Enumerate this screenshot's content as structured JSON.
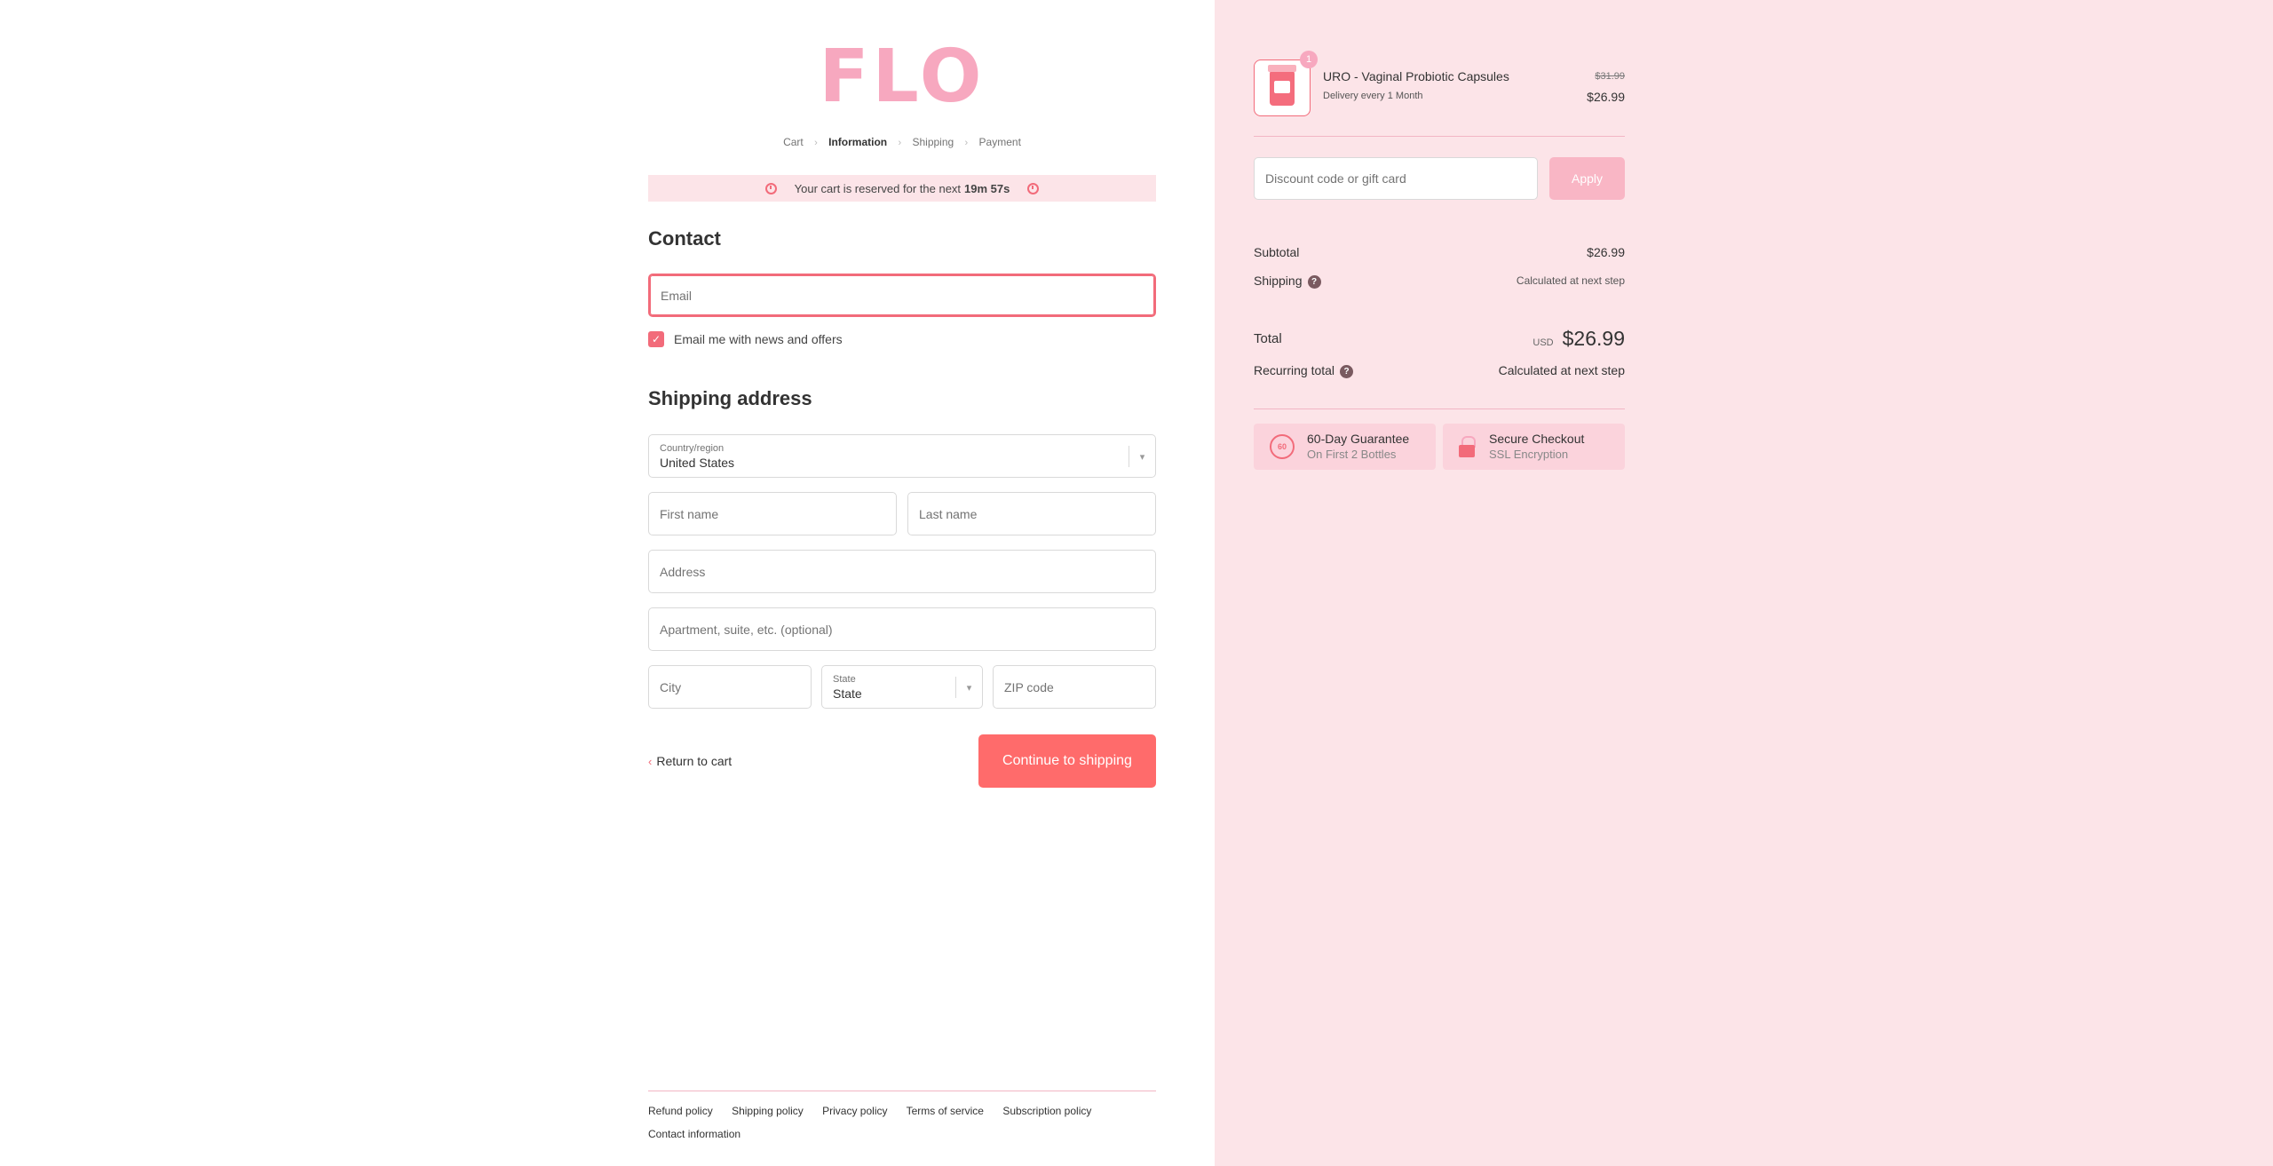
{
  "brand": {
    "logo_text": "FLO"
  },
  "breadcrumb": {
    "cart": "Cart",
    "information": "Information",
    "shipping": "Shipping",
    "payment": "Payment"
  },
  "banner": {
    "text": "Your cart is reserved for the next",
    "time": "19m 57s"
  },
  "contact": {
    "heading": "Contact",
    "email_placeholder": "Email",
    "newsletter_label": "Email me with news and offers",
    "newsletter_checked": true
  },
  "shipping": {
    "heading": "Shipping address",
    "country_label": "Country/region",
    "country_value": "United States",
    "first_name": "First name",
    "last_name": "Last name",
    "address": "Address",
    "apartment": "Apartment, suite, etc. (optional)",
    "city": "City",
    "state_label": "State",
    "state_value": "State",
    "zip": "ZIP code"
  },
  "actions": {
    "return": "Return to cart",
    "continue": "Continue to shipping"
  },
  "footer": {
    "links": [
      "Refund policy",
      "Shipping policy",
      "Privacy policy",
      "Terms of service",
      "Subscription policy"
    ],
    "contact": "Contact information"
  },
  "order": {
    "item": {
      "name": "URO - Vaginal Probiotic Capsules",
      "delivery": "Delivery every 1 Month",
      "quantity": "1",
      "original_price": "$31.99",
      "price": "$26.99"
    },
    "discount_placeholder": "Discount code or gift card",
    "apply_label": "Apply",
    "subtotal_label": "Subtotal",
    "subtotal_value": "$26.99",
    "shipping_label": "Shipping",
    "shipping_value": "Calculated at next step",
    "total_label": "Total",
    "total_currency": "USD",
    "total_value": "$26.99",
    "recurring_label": "Recurring total",
    "recurring_value": "Calculated at next step"
  },
  "badges": [
    {
      "icon": "60-day-badge-icon",
      "title": "60-Day Guarantee",
      "subtitle": "On First 2 Bottles",
      "icon_text": "60"
    },
    {
      "icon": "lock-icon",
      "title": "Secure Checkout",
      "subtitle": "SSL Encryption"
    }
  ],
  "colors": {
    "accent": "#f26b7a",
    "brand_pink": "#f7a8bf",
    "sidebar_bg": "#fce4e8",
    "button": "#ff6b6b"
  }
}
